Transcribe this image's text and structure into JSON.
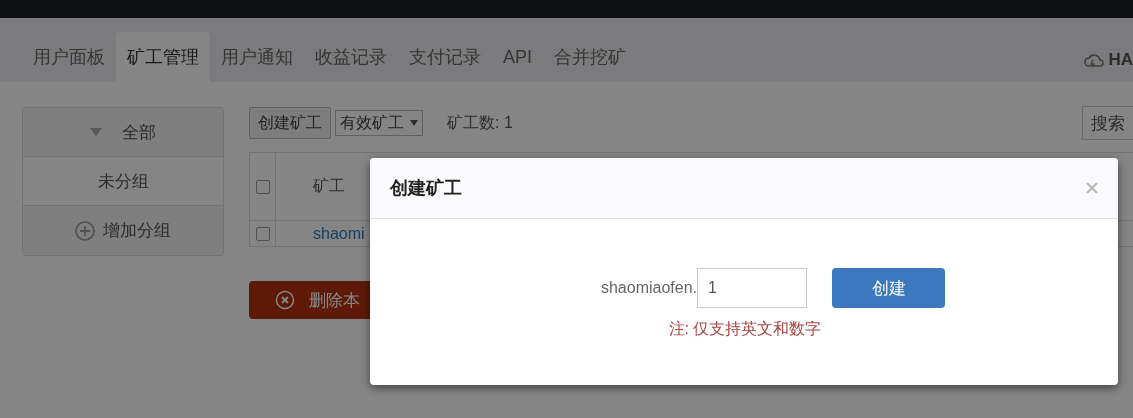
{
  "nav_tabs": [
    {
      "label": "用户面板",
      "selected": false
    },
    {
      "label": "矿工管理",
      "selected": true
    },
    {
      "label": "用户通知",
      "selected": false
    },
    {
      "label": "收益记录",
      "selected": false
    },
    {
      "label": "支付记录",
      "selected": false
    },
    {
      "label": "API",
      "selected": false
    },
    {
      "label": "合并挖矿",
      "selected": false
    }
  ],
  "brand": "HA",
  "sidebar": {
    "items": [
      {
        "label": "全部",
        "kind": "collapsible"
      },
      {
        "label": "未分组",
        "kind": "plain"
      },
      {
        "label": "增加分组",
        "kind": "add"
      }
    ]
  },
  "toolbar": {
    "create_button": "创建矿工",
    "filter": "有效矿工",
    "count": "矿工数: 1",
    "search_button": "搜索"
  },
  "table": {
    "header_checked": false,
    "columns": [
      "矿工"
    ],
    "rows": [
      {
        "checked": false,
        "column_1": "shaomi"
      }
    ]
  },
  "delete_button": "删除本",
  "modal": {
    "title": "创建矿工",
    "prefix": "shaomiaofen.",
    "value": "1",
    "submit": "创建",
    "note": "注: 仅支持英文和数字"
  }
}
